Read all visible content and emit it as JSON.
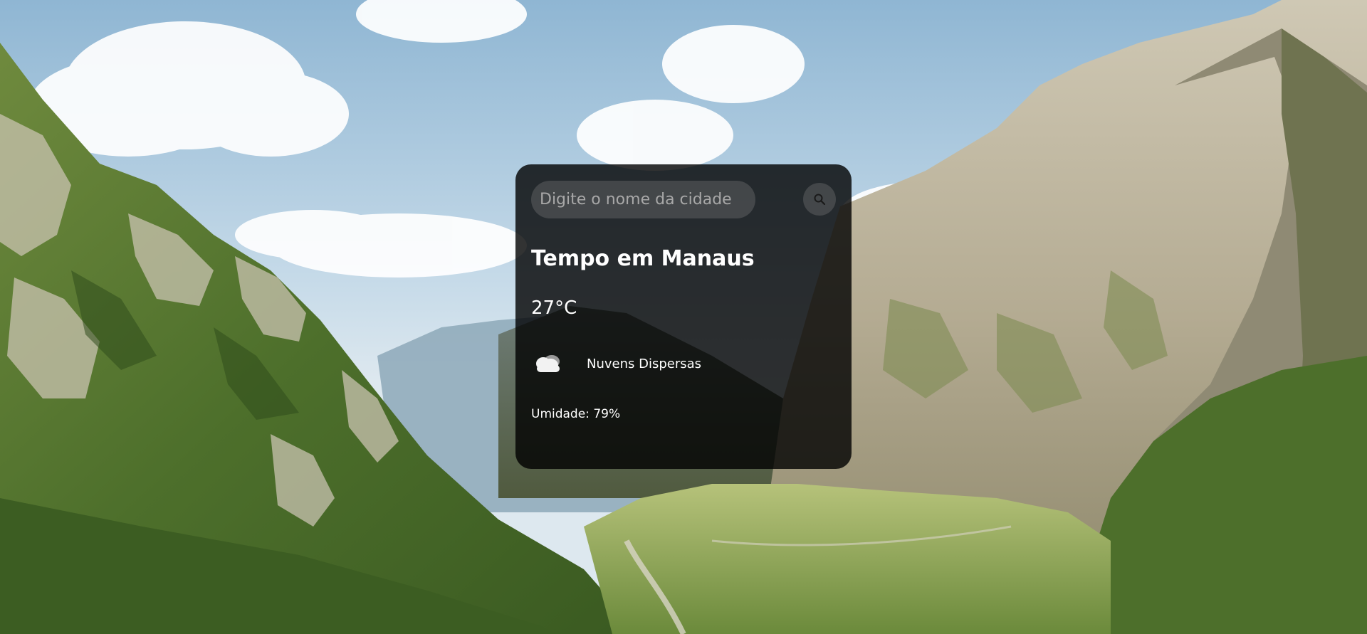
{
  "search": {
    "placeholder": "Digite o nome da cidade",
    "value": "",
    "button_icon": "search-icon"
  },
  "weather": {
    "city_title": "Tempo em Manaus",
    "temperature": "27°C",
    "icon": "cloud-icon",
    "description": "Nuvens Dispersas",
    "humidity": "Umidade: 79%"
  },
  "colors": {
    "card_background": "#000000cc",
    "text": "#ffffff",
    "placeholder": "#a8a8a8",
    "input_background": "#7d7d7d59"
  }
}
